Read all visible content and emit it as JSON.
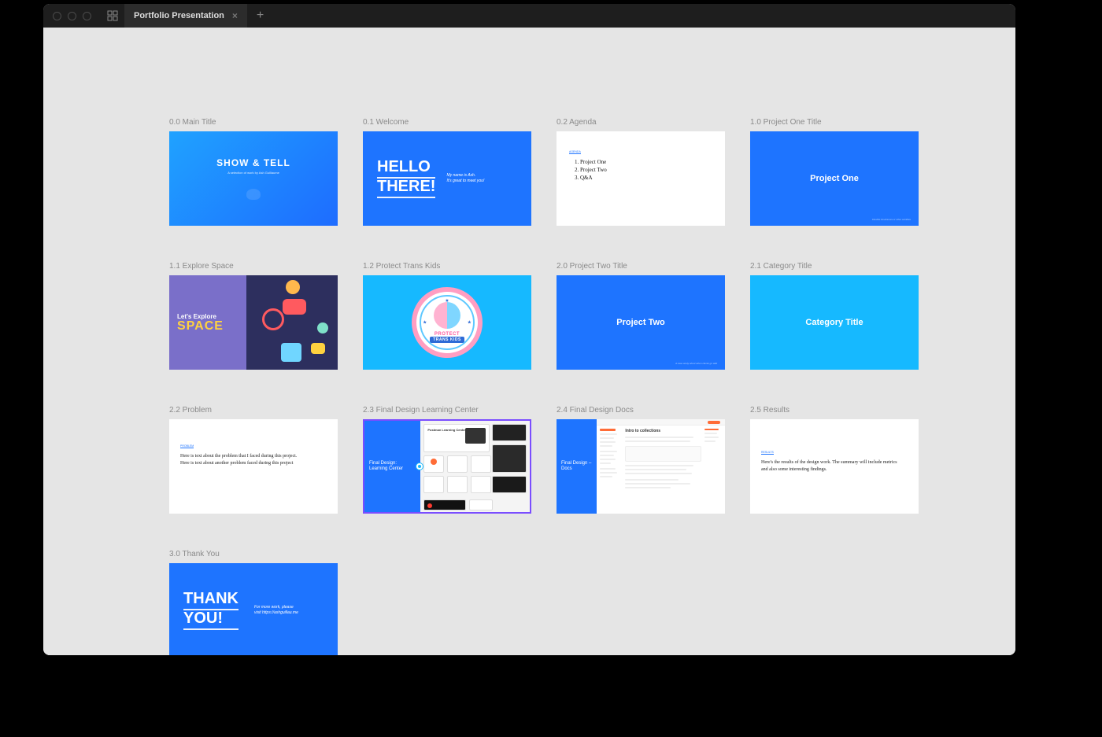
{
  "tab": {
    "title": "Portfolio Presentation"
  },
  "frames": {
    "f00": {
      "label": "0.0 Main Title",
      "title": "SHOW & TELL",
      "subtitle": "A selection of work by Ash Guillaume"
    },
    "f01": {
      "label": "0.1 Welcome",
      "line1": "HELLO",
      "line2": "THERE!",
      "sub1": "My name is Ash.",
      "sub2": "It's great to meet you!"
    },
    "f02": {
      "label": "0.2 Agenda",
      "header": "AGENDA",
      "item1": "Project One",
      "item2": "Project Two",
      "item3": "Q&A"
    },
    "f10": {
      "label": "1.0 Project One Title",
      "title": "Project One",
      "footer": "Flexible timeframes or other subtitles"
    },
    "f11": {
      "label": "1.1 Explore Space",
      "line1": "Let's Explore",
      "line2": "SPACE"
    },
    "f12": {
      "label": "1.2 Protect Trans Kids",
      "badge1": "PROTECT",
      "badge2": "TRANS KIDS"
    },
    "f20": {
      "label": "2.0 Project Two Title",
      "title": "Project Two",
      "footer": "A case study about when clients go wild"
    },
    "f21": {
      "label": "2.1 Category Title",
      "title": "Category Title"
    },
    "f22": {
      "label": "2.2 Problem",
      "header": "PROBLEM",
      "body": "Here is text about the problem that I faced during this project. Here is text about another problem faced during this project"
    },
    "f23": {
      "label": "2.3 Final Design Learning Center",
      "caption": "Final Design: Learning Center",
      "mock_title": "Postman Learning Center"
    },
    "f24": {
      "label": "2.4 Final Design Docs",
      "caption": "Final Design – Docs",
      "mock_title": "Intro to collections"
    },
    "f25": {
      "label": "2.5 Results",
      "header": "RESULTS",
      "body": "Here's the results of the design work. The summary will include metrics and also some interesting findings."
    },
    "f30": {
      "label": "3.0 Thank You",
      "line1": "THANK",
      "line2": "YOU!",
      "sub1": "For more work, please",
      "sub2": "visit https://ashguillau.me"
    }
  }
}
